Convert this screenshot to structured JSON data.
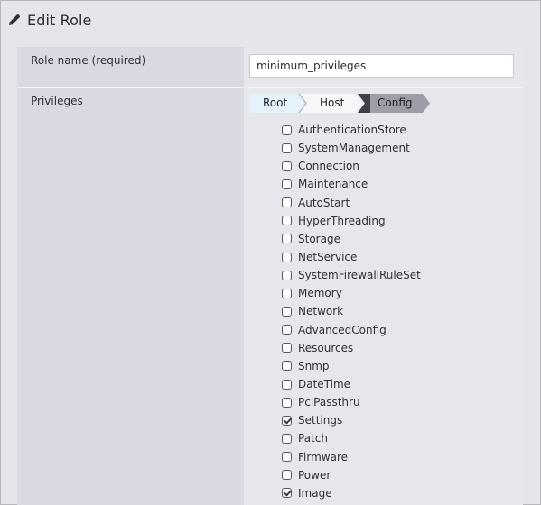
{
  "dialog": {
    "title": "Edit Role",
    "icon": "pencil-icon"
  },
  "form": {
    "role_name_label": "Role name (required)",
    "role_name_value": "minimum_privileges",
    "privileges_label": "Privileges"
  },
  "breadcrumb": {
    "items": [
      {
        "label": "Root"
      },
      {
        "label": "Host"
      },
      {
        "label": "Config"
      }
    ]
  },
  "privileges": [
    {
      "label": "AuthenticationStore",
      "checked": false
    },
    {
      "label": "SystemManagement",
      "checked": false
    },
    {
      "label": "Connection",
      "checked": false
    },
    {
      "label": "Maintenance",
      "checked": false
    },
    {
      "label": "AutoStart",
      "checked": false
    },
    {
      "label": "HyperThreading",
      "checked": false
    },
    {
      "label": "Storage",
      "checked": false
    },
    {
      "label": "NetService",
      "checked": false
    },
    {
      "label": "SystemFirewallRuleSet",
      "checked": false
    },
    {
      "label": "Memory",
      "checked": false
    },
    {
      "label": "Network",
      "checked": false
    },
    {
      "label": "AdvancedConfig",
      "checked": false
    },
    {
      "label": "Resources",
      "checked": false
    },
    {
      "label": "Snmp",
      "checked": false
    },
    {
      "label": "DateTime",
      "checked": false
    },
    {
      "label": "PciPassthru",
      "checked": false
    },
    {
      "label": "Settings",
      "checked": true
    },
    {
      "label": "Patch",
      "checked": false
    },
    {
      "label": "Firmware",
      "checked": false
    },
    {
      "label": "Power",
      "checked": false
    },
    {
      "label": "Image",
      "checked": true
    }
  ],
  "colors": {
    "left_panel": "#d9d9e3",
    "right_panel": "#e7e6ec",
    "crumb_root": "#e6f2fa",
    "crumb_host": "#f7f7fa",
    "crumb_config": "#9e9da7"
  }
}
